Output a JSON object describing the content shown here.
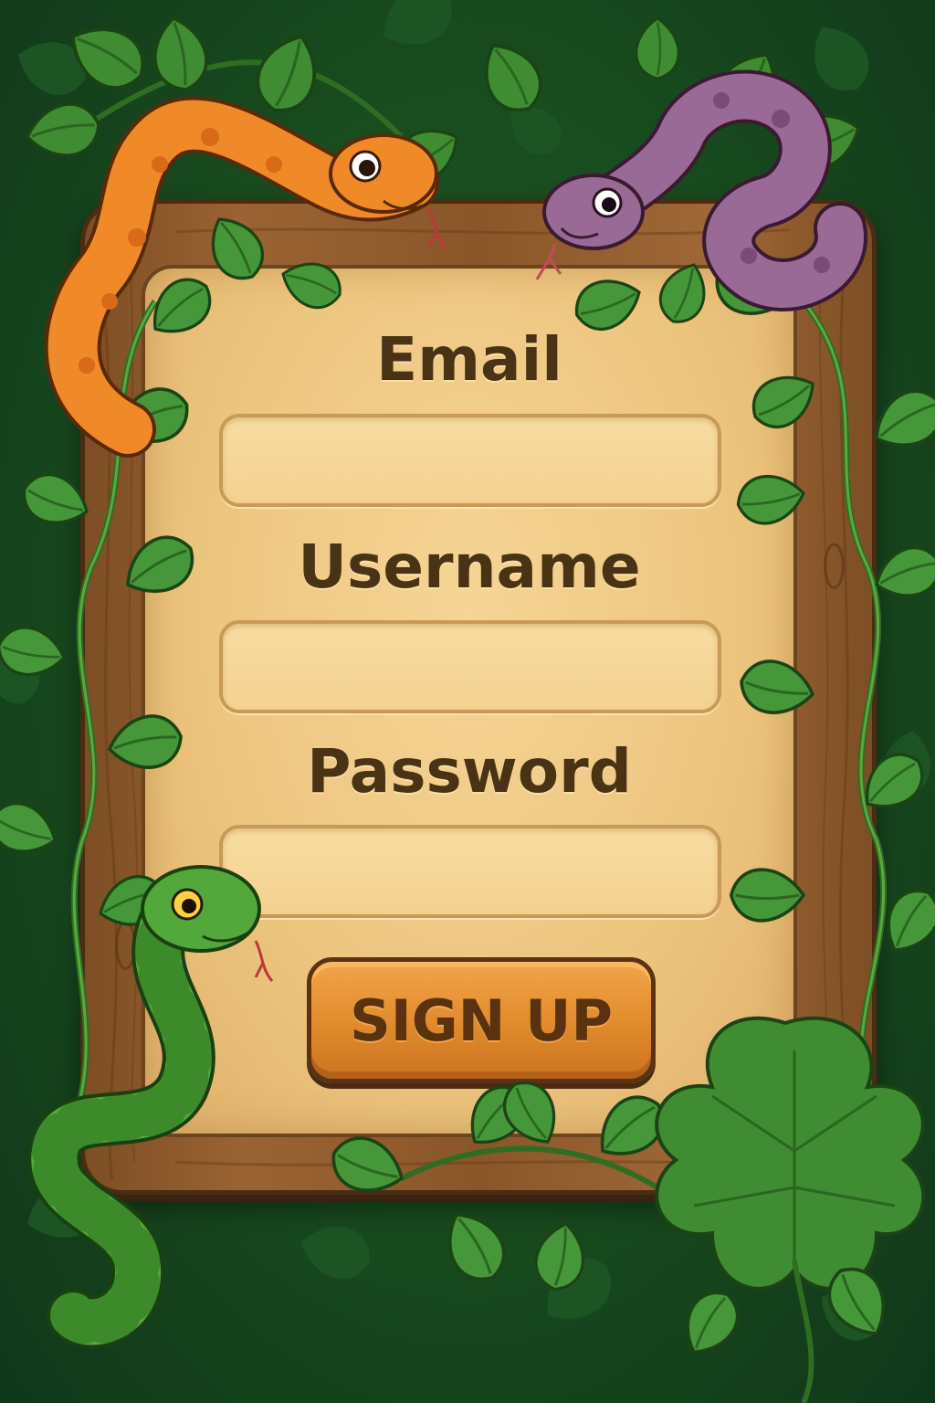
{
  "form": {
    "email_label": "Email",
    "email_value": "",
    "username_label": "Username",
    "username_value": "",
    "password_label": "Password",
    "password_value": "",
    "signup_label": "SIGN UP"
  },
  "decorations": {
    "snakes": [
      "orange-snake-icon",
      "purple-snake-icon",
      "green-snake-icon"
    ],
    "foliage": "jungle-vine-icon"
  },
  "colors": {
    "background": "#184a1e",
    "panel": "#ecc47e",
    "board": "#8a5629",
    "button": "#e08a2c",
    "label_text": "#4a3214"
  }
}
